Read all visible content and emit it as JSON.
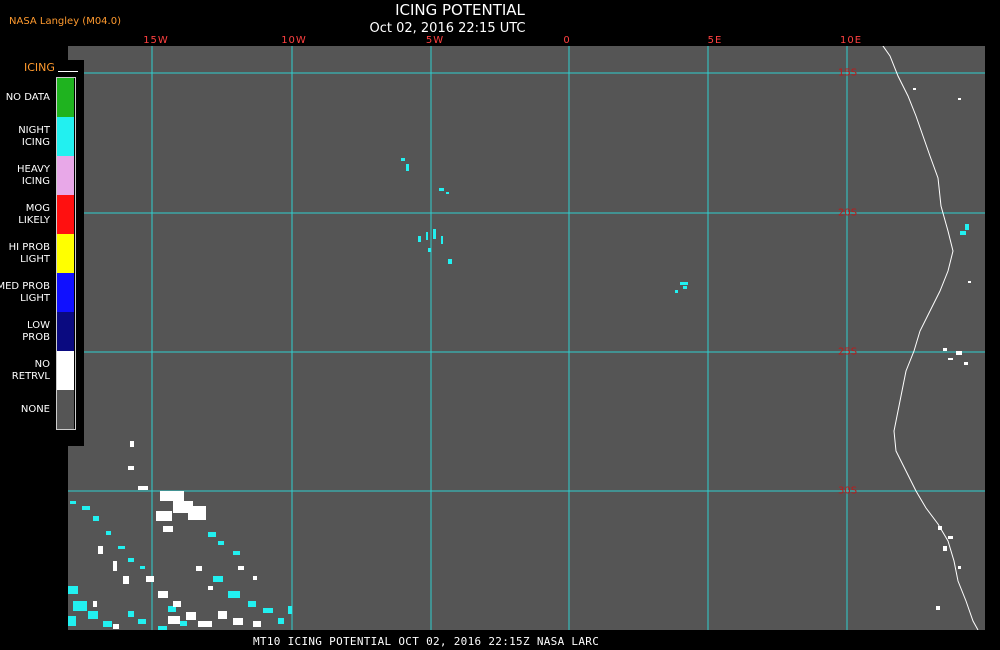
{
  "header": {
    "credit": "NASA Langley (M04.0)",
    "title": "ICING POTENTIAL",
    "datetime": "Oct 02, 2016 22:15 UTC"
  },
  "map": {
    "longitude_labels": [
      "15W",
      "10W",
      "5W",
      "0",
      "5E",
      "10E"
    ],
    "latitude_labels": [
      "15S",
      "20S",
      "25S",
      "30S"
    ],
    "background_color": "#555555",
    "grid_color": "#2fd0d0"
  },
  "legend": {
    "title": "ICING",
    "items": [
      {
        "label": "NO DATA",
        "color": "#1fb31f"
      },
      {
        "label": "NIGHT\nICING",
        "color": "#22f0f0"
      },
      {
        "label": "HEAVY\nICING",
        "color": "#e8a8e8"
      },
      {
        "label": "MOG\nLIKELY",
        "color": "#ff1010"
      },
      {
        "label": "HI PROB\nLIGHT",
        "color": "#ffff00"
      },
      {
        "label": "MED PROB\nLIGHT",
        "color": "#1010ff"
      },
      {
        "label": "LOW\nPROB",
        "color": "#0a0a80"
      },
      {
        "label": "NO\nRETRVL",
        "color": "#ffffff"
      },
      {
        "label": "NONE",
        "color": "#555555"
      }
    ]
  },
  "footer": {
    "caption": "MT10  ICING POTENTIAL   OCT 02, 2016 22:15Z   NASA LARC"
  }
}
